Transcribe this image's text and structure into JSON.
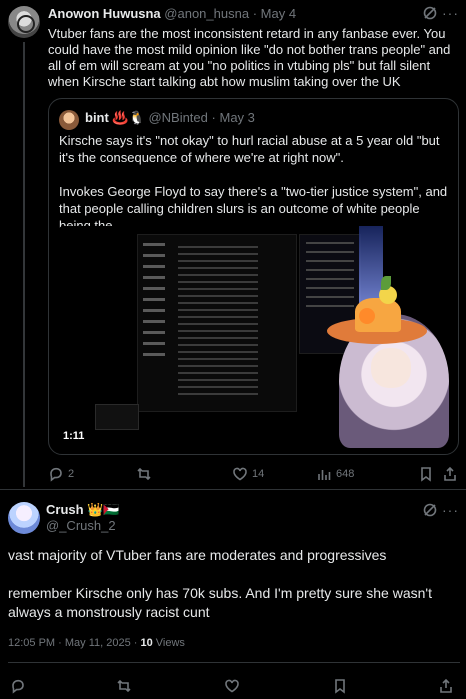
{
  "post1": {
    "name": "Anowon Huwusna",
    "handle": "@anon_husna",
    "sep": "·",
    "date": "May 4",
    "text": "Vtuber fans are the most inconsistent retard in any fanbase ever. You could have the most mild opinion like \"do not bother trans people\" and all of em will scream at you \"no politics in vtubing pls\" but fall silent when Kirsche start talking abt how muslim taking over the UK",
    "quote": {
      "name": "bint ♨️🐧",
      "handle": "@NBinted",
      "sep": "·",
      "date": "May 3",
      "para1": "Kirsche says it's \"not okay\" to hurl racial abuse at a 5 year old \"but it's the consequence of where we're at right now\".",
      "para2": "Invokes George Floyd to say there's a \"two-tier justice system\", and that people calling children slurs is an outcome of white people being the …",
      "video_time": "1:11"
    },
    "actions": {
      "replies": "2",
      "reposts": "",
      "likes": "14",
      "views": "648"
    }
  },
  "post2": {
    "name": "Crush",
    "name_emoji": "👑🇵🇸",
    "handle": "@_Crush_2",
    "para1": "vast majority of VTuber fans are moderates and progressives",
    "para2": "remember Kirsche only has 70k subs. And I'm pretty sure she wasn't always a monstrously racist cunt",
    "time": "12:05 PM · May 11, 2025 · ",
    "views_count": "10",
    "views_label": " Views"
  },
  "icons": [
    "grok-icon",
    "more-icon",
    "reply-icon",
    "repost-icon",
    "like-icon",
    "views-icon",
    "bookmark-icon",
    "share-icon"
  ]
}
